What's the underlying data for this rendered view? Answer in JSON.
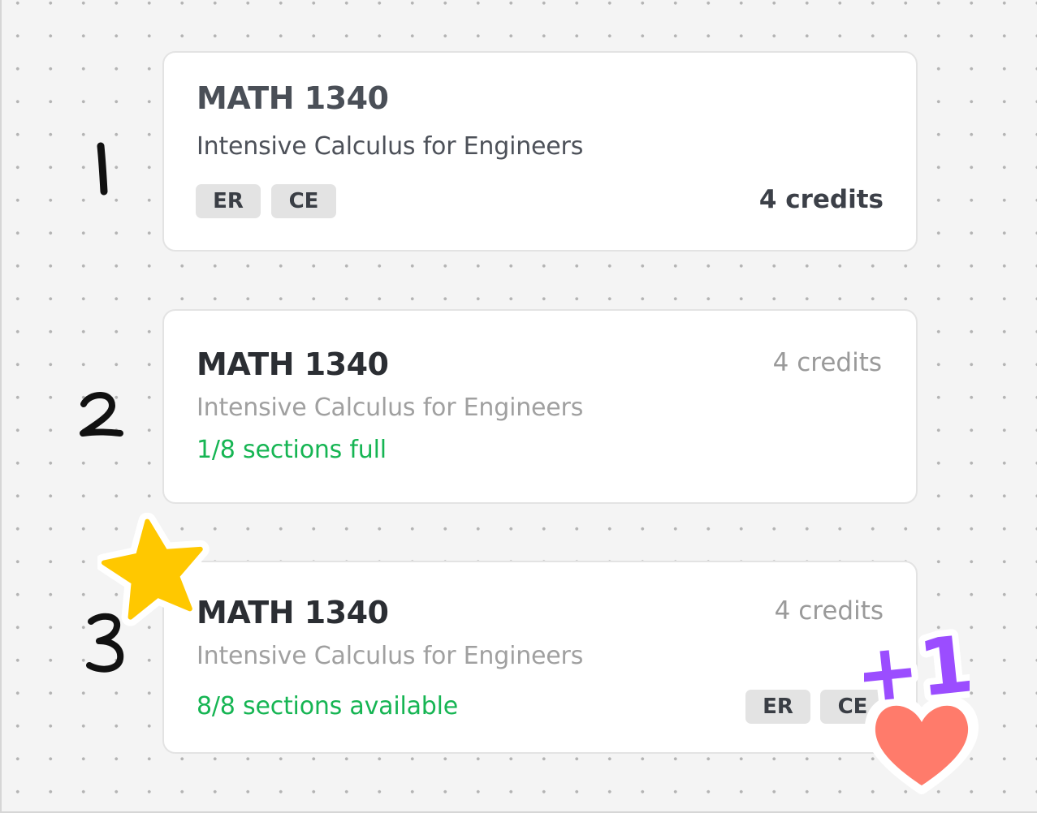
{
  "cards": [
    {
      "code": "MATH 1340",
      "title": "Intensive Calculus for Engineers",
      "credits": "4 credits",
      "tags": [
        "ER",
        "CE"
      ]
    },
    {
      "code": "MATH 1340",
      "title": "Intensive Calculus for Engineers",
      "credits": "4 credits",
      "status": "1/8 sections full"
    },
    {
      "code": "MATH 1340",
      "title": "Intensive Calculus for Engineers",
      "credits": "4 credits",
      "status": "8/8 sections available",
      "tags": [
        "ER",
        "CE"
      ]
    }
  ],
  "annotations": {
    "numbers": [
      "1",
      "2",
      "3"
    ],
    "sticker_text": "+1"
  },
  "colors": {
    "status_green": "#16b553",
    "tag_background": "#e3e3e3",
    "star": "#ffc800",
    "heart": "#ff7b6b",
    "plus_one": "#9b4dff"
  }
}
